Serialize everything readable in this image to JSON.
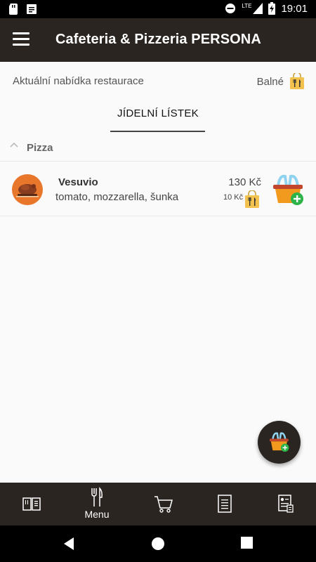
{
  "status_bar": {
    "time": "19:01",
    "network": "LTE",
    "icons": [
      "sd-card-icon",
      "notification-icon",
      "do-not-disturb-icon",
      "signal-icon",
      "battery-charging-icon"
    ]
  },
  "app_bar": {
    "title": "Cafeteria & Pizzeria PERSONA",
    "menu_icon": "hamburger-icon"
  },
  "info": {
    "text": "Aktuální nabídka restaurace",
    "location": "Balné",
    "location_icon": "takeaway-bag-icon"
  },
  "tab": {
    "label": "JÍDELNÍ LÍSTEK"
  },
  "category": {
    "label": "Pizza",
    "icon": "chevron-up-icon"
  },
  "items": [
    {
      "name": "Vesuvio",
      "description": "tomato, mozzarella, šunka",
      "price": "130 Kč",
      "packaging_price": "10 Kč",
      "image_icon": "roast-food-icon",
      "add_icon": "add-to-basket-icon"
    }
  ],
  "fab": {
    "icon": "basket-icon"
  },
  "bottom_nav": {
    "items": [
      {
        "icon": "menu-book-icon",
        "label": ""
      },
      {
        "icon": "fork-knife-icon",
        "label": "Menu"
      },
      {
        "icon": "cart-icon",
        "label": ""
      },
      {
        "icon": "receipt-icon",
        "label": ""
      },
      {
        "icon": "contact-card-icon",
        "label": ""
      }
    ]
  },
  "colors": {
    "bar_bg": "#2a2520",
    "accent_orange": "#e8762b",
    "bag_yellow": "#f2c14e",
    "add_green": "#2db34a",
    "page_bg": "#fafafa"
  }
}
